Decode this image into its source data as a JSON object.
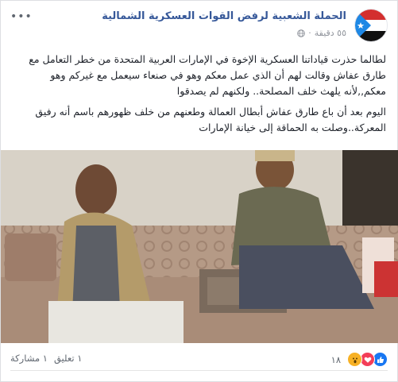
{
  "post": {
    "page_name": "الحملة الشعبية لرفض القوات العسكرية الشمالية",
    "time": "٥٥ دقيقة",
    "time_separator": "·",
    "menu": "•••",
    "paragraphs": [
      "لطالما حذرت قياداتنا العسكرية الإخوة في الإمارات العربية المتحدة من خطر التعامل مع طارق عفاش وقالت لهم أن الذي عمل معكم وهو في صنعاء سيعمل مع غيركم وهو معكم,,لأنه يلهث خلف المصلحة.. ولكنهم لم يصدقوا",
      "اليوم بعد أن باع طارق عفاش أبطال العمالة وطعنهم من خلف ظهورهم باسم أنه رفيق المعركة..وصلت به الحماقة إلى خيانة الإمارات"
    ]
  },
  "footer": {
    "reaction_count": "١٨",
    "comments": "١ تعليق",
    "shares": "١ مشاركة"
  },
  "colors": {
    "page_name": "#365899",
    "like": "#1877f2",
    "love": "#f33e58",
    "wow": "#f7b125"
  },
  "icons": [
    "flag-avatar",
    "globe-icon",
    "more-options-icon",
    "like-icon",
    "love-icon",
    "wow-icon"
  ]
}
